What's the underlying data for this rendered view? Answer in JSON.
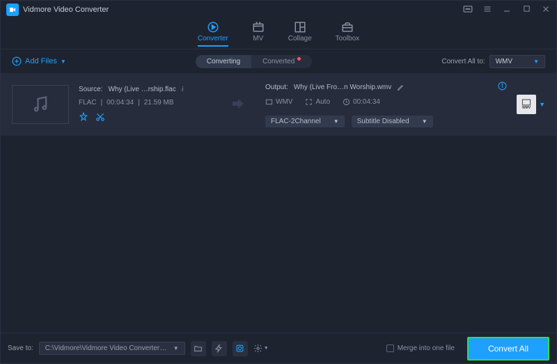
{
  "app": {
    "title": "Vidmore Video Converter"
  },
  "tabs": [
    {
      "label": "Converter",
      "active": true
    },
    {
      "label": "MV",
      "active": false
    },
    {
      "label": "Collage",
      "active": false
    },
    {
      "label": "Toolbox",
      "active": false
    }
  ],
  "toolbar": {
    "add_files": "Add Files",
    "converting": "Converting",
    "converted": "Converted",
    "convert_all_to": "Convert All to:",
    "target_format": "WMV"
  },
  "item": {
    "source_label": "Source:",
    "source_name": "Why (Live …rship.flac",
    "codec": "FLAC",
    "duration": "00:04:34",
    "size": "21.59 MB",
    "output_label": "Output:",
    "output_name": "Why (Live Fro…n Worship.wmv",
    "out_format": "WMV",
    "out_resolution": "Auto",
    "out_duration": "00:04:34",
    "audio_sel": "FLAC-2Channel",
    "subtitle_sel": "Subtitle Disabled",
    "fmt_badge": "WMV"
  },
  "footer": {
    "save_to_label": "Save to:",
    "save_path": "C:\\Vidmore\\Vidmore Video Converter\\Converted",
    "merge": "Merge into one file",
    "convert_all": "Convert All"
  }
}
